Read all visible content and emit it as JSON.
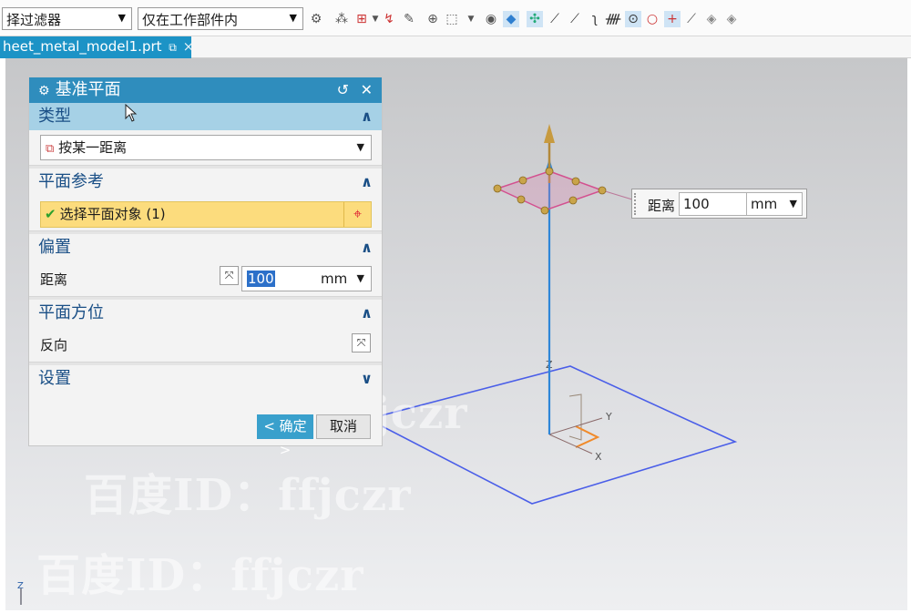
{
  "toolbar": {
    "filter_select": "择过滤器",
    "scope_select": "仅在工作部件内"
  },
  "tab": {
    "filename": "heet_metal_model1.prt",
    "pin_glyph": "⧉",
    "close_glyph": "×"
  },
  "dialog": {
    "title": "基准平面",
    "reset_glyph": "↺",
    "close_glyph": "✕",
    "type_section": {
      "header": "类型",
      "value": "按某一距离"
    },
    "reference_section": {
      "header": "平面参考",
      "selected": "选择平面对象 (1)"
    },
    "offset_section": {
      "header": "偏置",
      "label": "距离",
      "value": "100",
      "unit": "mm"
    },
    "orientation_section": {
      "header": "平面方位",
      "label": "反向"
    },
    "settings_section": {
      "header": "设置"
    },
    "ok_label": "< 确定 >",
    "cancel_label": "取消"
  },
  "distance_popup": {
    "label": "距离",
    "value": "100",
    "unit": "mm"
  },
  "axes": {
    "x": "X",
    "y": "Y",
    "z": "Z",
    "corner_z": "Z"
  },
  "watermarks": [
    "百度ID：ffjczr",
    "百度ID：ffjczr",
    "百度ID：ffjczr"
  ],
  "colors": {
    "title_bar": "#2f8dbd",
    "section_active": "#a6d1e6",
    "selection_row": "#fcdc7d",
    "plane_edge": "#4a5ee8",
    "datum_plane_edge": "#d3508f",
    "normal_vector": "#2e86d8",
    "handle": "#c9a44a"
  },
  "icons": {
    "title_icon": "gear-icon",
    "type_icon": "datum-plane-distance-icon",
    "check_icon": "check-icon",
    "crosshair_icon": "crosshair-icon",
    "flip_icon": "flip-direction-icon",
    "chevron_up": "chevron-up-icon",
    "chevron_down": "chevron-down-icon"
  }
}
